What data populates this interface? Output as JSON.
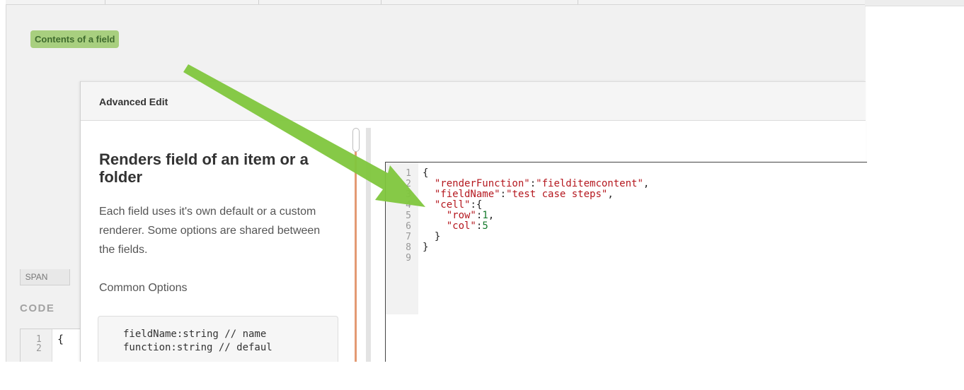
{
  "badge": {
    "label": "Contents of a field",
    "color": "#a8cf7f"
  },
  "background": {
    "span_tab": "SPAN",
    "code_label": "CODE",
    "editor_lines": [
      "1",
      "2"
    ],
    "editor_first_char": "{"
  },
  "modal": {
    "title": "Advanced Edit",
    "heading": "Renders field of an item or a folder",
    "description": "Each field uses it's own default or a custom renderer. Some options are shared between the fields.",
    "subheading": "Common Options",
    "options_code": "fieldName:string // name\nfunction:string // defaul"
  },
  "editor": {
    "line_numbers": [
      "1",
      "2",
      "3",
      "4",
      "5",
      "6",
      "7",
      "8",
      "9"
    ],
    "lines": [
      "{",
      "  \"renderFunction\":\"fielditemcontent\",",
      "  \"fieldName\":\"test case steps\",",
      "  \"cell\":{",
      "    \"row\":1,",
      "    \"col\":5",
      "  }",
      "}",
      ""
    ]
  },
  "colors": {
    "accent_arrow": "#7fc63d",
    "scroll_line": "#e39a73",
    "json_key": "#b5181f",
    "json_number": "#157a2c"
  },
  "icons": [
    "pointer-arrow"
  ]
}
